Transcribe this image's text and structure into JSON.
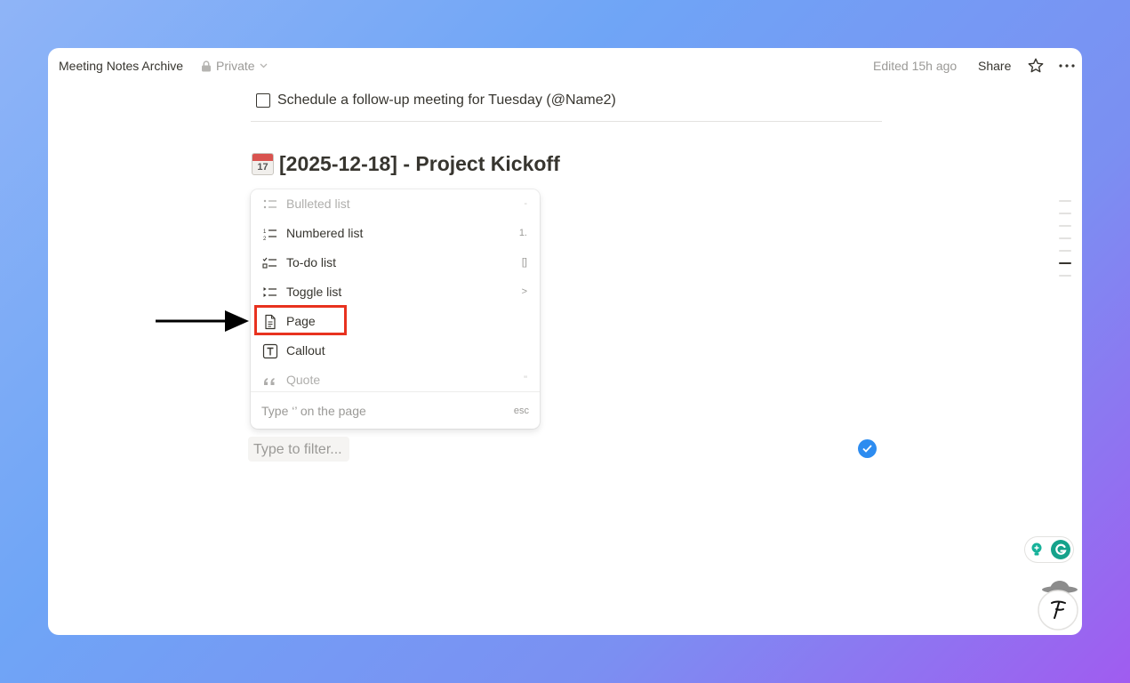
{
  "topbar": {
    "page_title": "Meeting Notes Archive",
    "privacy": "Private",
    "edited": "Edited 15h ago",
    "share": "Share"
  },
  "todo": {
    "text": "Schedule a follow-up meeting for Tuesday (@Name2)",
    "checked": false
  },
  "heading": {
    "icon_day": "17",
    "text": "[2025-12-18] - Project Kickoff"
  },
  "menu": {
    "items": [
      {
        "label": "Bulleted list",
        "shortcut": "-",
        "icon": "bulleted-list-icon"
      },
      {
        "label": "Numbered list",
        "shortcut": "1.",
        "icon": "numbered-list-icon"
      },
      {
        "label": "To-do list",
        "shortcut": "[]",
        "icon": "todo-list-icon"
      },
      {
        "label": "Toggle list",
        "shortcut": ">",
        "icon": "toggle-list-icon"
      },
      {
        "label": "Page",
        "shortcut": "",
        "icon": "page-icon"
      },
      {
        "label": "Callout",
        "shortcut": "",
        "icon": "callout-icon"
      },
      {
        "label": "Quote",
        "shortcut": "\"",
        "icon": "quote-icon"
      }
    ],
    "footer_hint": "Type ‘’ on the page",
    "footer_esc": "esc"
  },
  "filter": {
    "placeholder": "Type to filter..."
  },
  "colors": {
    "highlight": "#e8321f",
    "accent": "#2d8cf0",
    "grammarly": "#15a28b"
  }
}
